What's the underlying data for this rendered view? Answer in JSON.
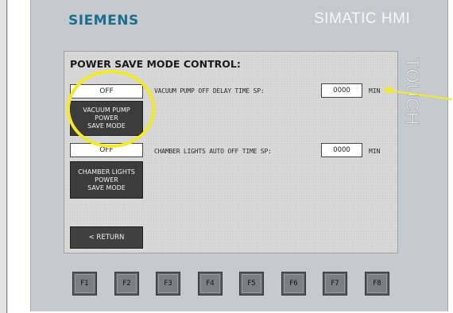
{
  "brand": {
    "logo": "SIEMENS",
    "product": "SIMATIC HMI",
    "side_text": "TOUCH"
  },
  "screen": {
    "title": "POWER SAVE MODE CONTROL:",
    "vacuum_pump": {
      "status": "OFF",
      "button_lines": [
        "VACUUM PUMP",
        "POWER",
        "SAVE MODE"
      ],
      "setpoint_label": "VACUUM PUMP OFF DELAY TIME SP:",
      "setpoint_value": "0000",
      "unit": "MIN"
    },
    "chamber_lights": {
      "status": "OFF",
      "button_lines": [
        "CHAMBER LIGHTS",
        "POWER",
        "SAVE MODE"
      ],
      "setpoint_label": "CHAMBER LIGHTS AUTO OFF TIME SP:",
      "setpoint_value": "0000",
      "unit": "MIN"
    },
    "return_label": "< RETURN"
  },
  "function_keys": [
    "F1",
    "F2",
    "F3",
    "F4",
    "F5",
    "F6",
    "F7",
    "F8"
  ],
  "colors": {
    "highlight": "#f2ea28",
    "siemens_brand": "#1a6f8f"
  }
}
